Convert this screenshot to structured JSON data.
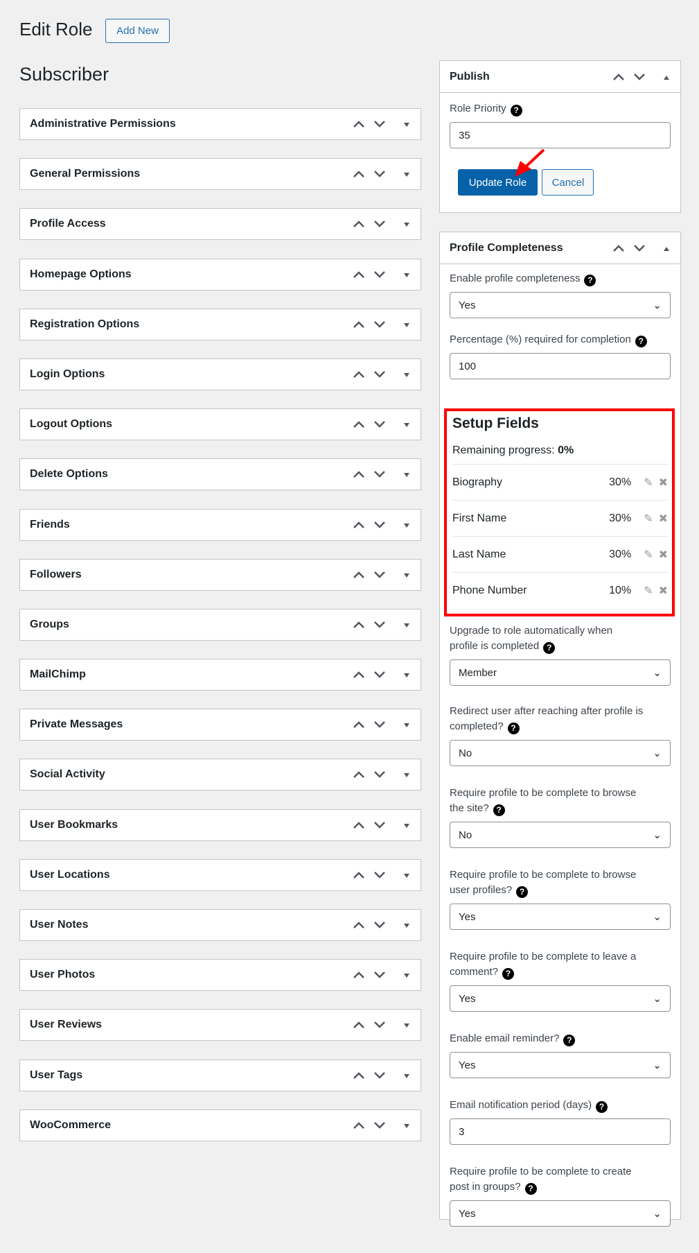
{
  "header": {
    "title": "Edit Role",
    "add_new": "Add New",
    "role_name": "Subscriber"
  },
  "sections": [
    "Administrative Permissions",
    "General Permissions",
    "Profile Access",
    "Homepage Options",
    "Registration Options",
    "Login Options",
    "Logout Options",
    "Delete Options",
    "Friends",
    "Followers",
    "Groups",
    "MailChimp",
    "Private Messages",
    "Social Activity",
    "User Bookmarks",
    "User Locations",
    "User Notes",
    "User Photos",
    "User Reviews",
    "User Tags",
    "WooCommerce"
  ],
  "publish": {
    "title": "Publish",
    "role_priority_label": "Role Priority",
    "role_priority": "35",
    "update": "Update Role",
    "cancel": "Cancel"
  },
  "profile": {
    "title": "Profile Completeness",
    "enable_label": "Enable profile completeness",
    "enable": "Yes",
    "percent_label": "Percentage (%) required for completion",
    "percent": "100",
    "setup_title": "Setup Fields",
    "remaining_label": "Remaining progress:",
    "remaining": "0%",
    "fields": [
      {
        "name": "Biography",
        "pct": "30%"
      },
      {
        "name": "First Name",
        "pct": "30%"
      },
      {
        "name": "Last Name",
        "pct": "30%"
      },
      {
        "name": "Phone Number",
        "pct": "10%"
      }
    ],
    "options": [
      {
        "label": "Upgrade to role automatically when profile is completed",
        "value": "Member",
        "type": "select"
      },
      {
        "label": "Redirect user after reaching after profile is completed?",
        "value": "No",
        "type": "select"
      },
      {
        "label": "Require profile to be complete to browse the site?",
        "value": "No",
        "type": "select"
      },
      {
        "label": "Require profile to be complete to browse user profiles?",
        "value": "Yes",
        "type": "select"
      },
      {
        "label": "Require profile to be complete to leave a comment?",
        "value": "Yes",
        "type": "select"
      },
      {
        "label": "Enable email reminder?",
        "value": "Yes",
        "type": "select"
      },
      {
        "label": "Email notification period (days)",
        "value": "3",
        "type": "input"
      },
      {
        "label": "Require profile to be complete to create post in groups?",
        "value": "Yes",
        "type": "select"
      }
    ]
  }
}
